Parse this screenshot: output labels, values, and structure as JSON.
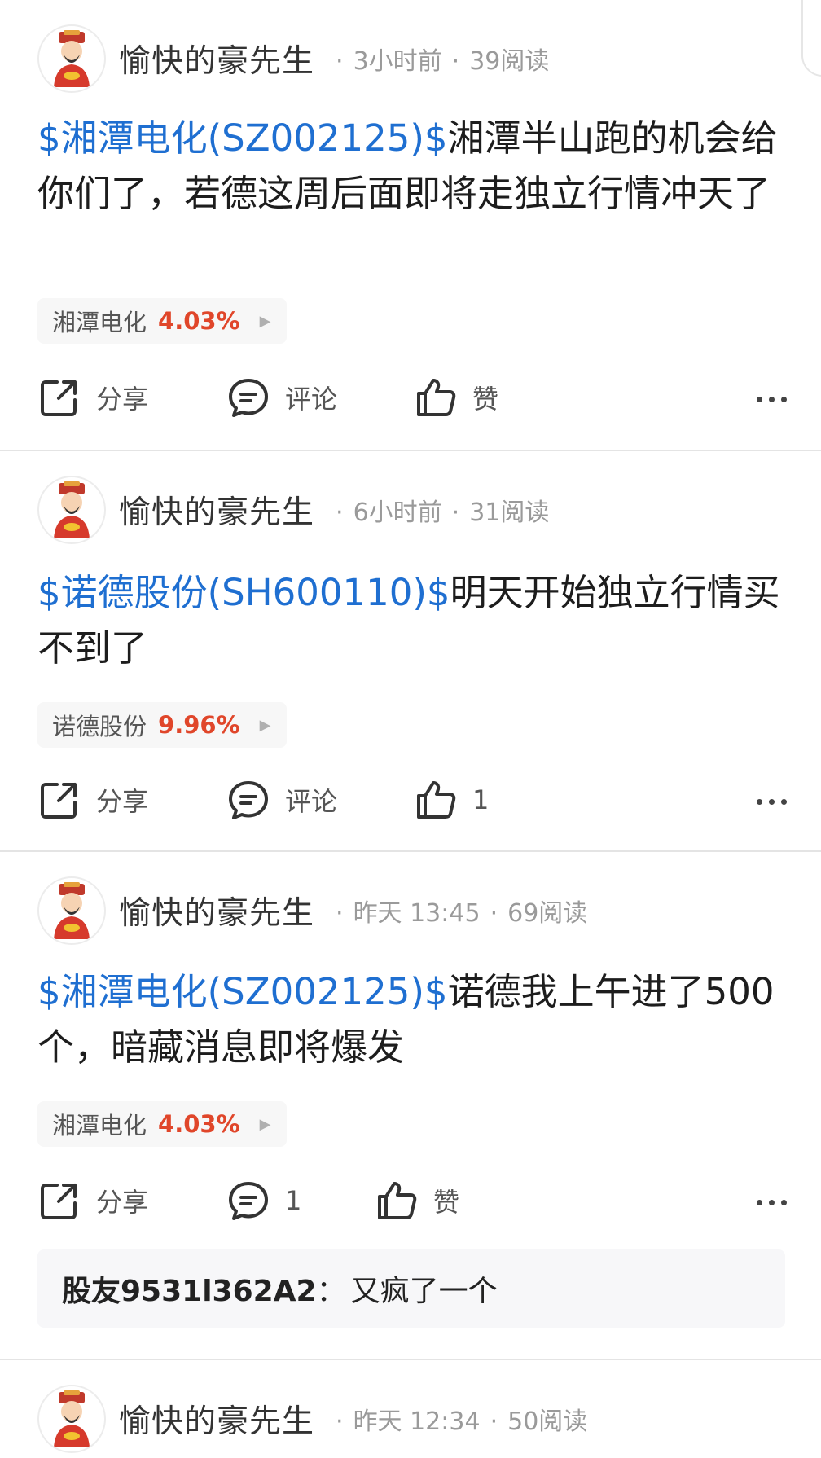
{
  "posts": [
    {
      "author": "愉快的豪先生",
      "time": "3小时前",
      "reads": "39阅读",
      "stock_link": "$湘潭电化(SZ002125)$",
      "text": "湘潭半山跑的机会给你们了，若德这周后面即将走独立行情冲天了",
      "tag": {
        "name": "湘潭电化",
        "change": "4.03%"
      },
      "actions": {
        "share": "分享",
        "comment": "评论",
        "like": "赞"
      }
    },
    {
      "author": "愉快的豪先生",
      "time": "6小时前",
      "reads": "31阅读",
      "stock_link": "$诺德股份(SH600110)$",
      "text": "明天开始独立行情买不到了",
      "tag": {
        "name": "诺德股份",
        "change": "9.96%"
      },
      "actions": {
        "share": "分享",
        "comment": "评论",
        "like": "1"
      }
    },
    {
      "author": "愉快的豪先生",
      "time": "昨天 13:45",
      "reads": "69阅读",
      "stock_link": "$湘潭电化(SZ002125)$",
      "text": "诺德我上午进了500个，暗藏消息即将爆发",
      "tag": {
        "name": "湘潭电化",
        "change": "4.03%"
      },
      "actions": {
        "share": "分享",
        "comment": "1",
        "like": "赞"
      },
      "comment": {
        "user": "股友9531l362A2",
        "separator": "：",
        "text": "又疯了一个"
      }
    },
    {
      "author": "愉快的豪先生",
      "time": "昨天 12:34",
      "reads": "50阅读"
    }
  ],
  "colors": {
    "link": "#1f6fd1",
    "rise": "#e0462a"
  },
  "icons": {
    "avatar": "caishen-avatar",
    "share": "share-icon",
    "comment": "comment-icon",
    "like": "thumbs-up-icon",
    "more": "more-dots-icon"
  }
}
